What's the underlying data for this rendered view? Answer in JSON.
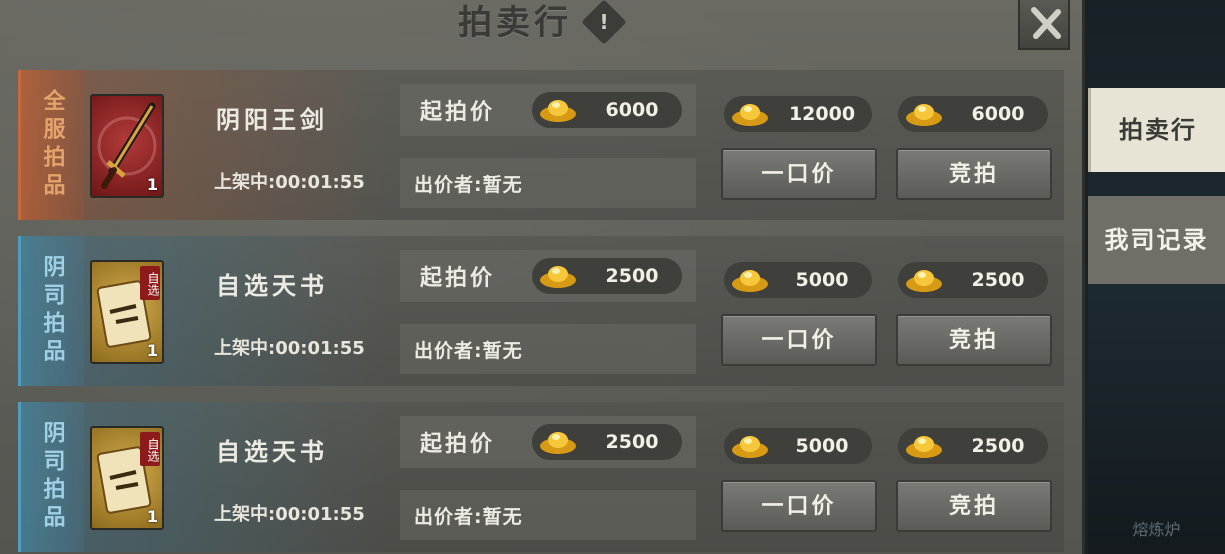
{
  "window": {
    "title": "拍卖行",
    "info_icon": "info-icon",
    "close_icon": "close-icon"
  },
  "side_tabs": [
    {
      "label": "拍卖行",
      "active": true
    },
    {
      "label": "我司记录",
      "active": false
    }
  ],
  "side_footer": "熔炼炉",
  "labels": {
    "start_price": "起拍价",
    "buyout_button": "一口价",
    "bid_button": "竞拍"
  },
  "colors": {
    "global_tag": "#e4a36a",
    "local_tag": "#9fd0e6"
  },
  "listings": [
    {
      "tag": "全服拍品",
      "tag_type": "global",
      "icon": "sword-icon",
      "count": "1",
      "stamp": "",
      "name": "阴阳王剑",
      "time": "上架中:00:01:55",
      "start_price": "6000",
      "bidder": "出价者:暂无",
      "buyout_price": "12000",
      "bid_price": "6000"
    },
    {
      "tag": "阴司拍品",
      "tag_type": "local",
      "icon": "scroll-icon",
      "count": "1",
      "stamp": "自选",
      "name": "自选天书",
      "time": "上架中:00:01:55",
      "start_price": "2500",
      "bidder": "出价者:暂无",
      "buyout_price": "5000",
      "bid_price": "2500"
    },
    {
      "tag": "阴司拍品",
      "tag_type": "local",
      "icon": "scroll-icon",
      "count": "1",
      "stamp": "自选",
      "name": "自选天书",
      "time": "上架中:00:01:55",
      "start_price": "2500",
      "bidder": "出价者:暂无",
      "buyout_price": "5000",
      "bid_price": "2500"
    }
  ]
}
